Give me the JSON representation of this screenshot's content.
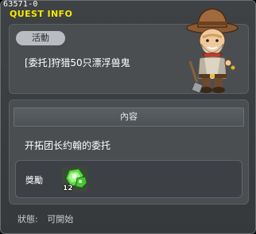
{
  "window": {
    "id_text": "63571-0",
    "title": "QUEST INFO"
  },
  "quest": {
    "category_badge": "活動",
    "name": "[委托]狩猎50只漂浮兽鬼"
  },
  "content": {
    "header": "內容",
    "description": "开拓团长约翰的委托"
  },
  "reward": {
    "label": "獎勵",
    "item_count": "12",
    "item_icon": "green-gem-icon"
  },
  "status": {
    "label": "狀態:",
    "value": "可開始"
  },
  "npc": {
    "icon": "cowboy-npc-icon"
  }
}
